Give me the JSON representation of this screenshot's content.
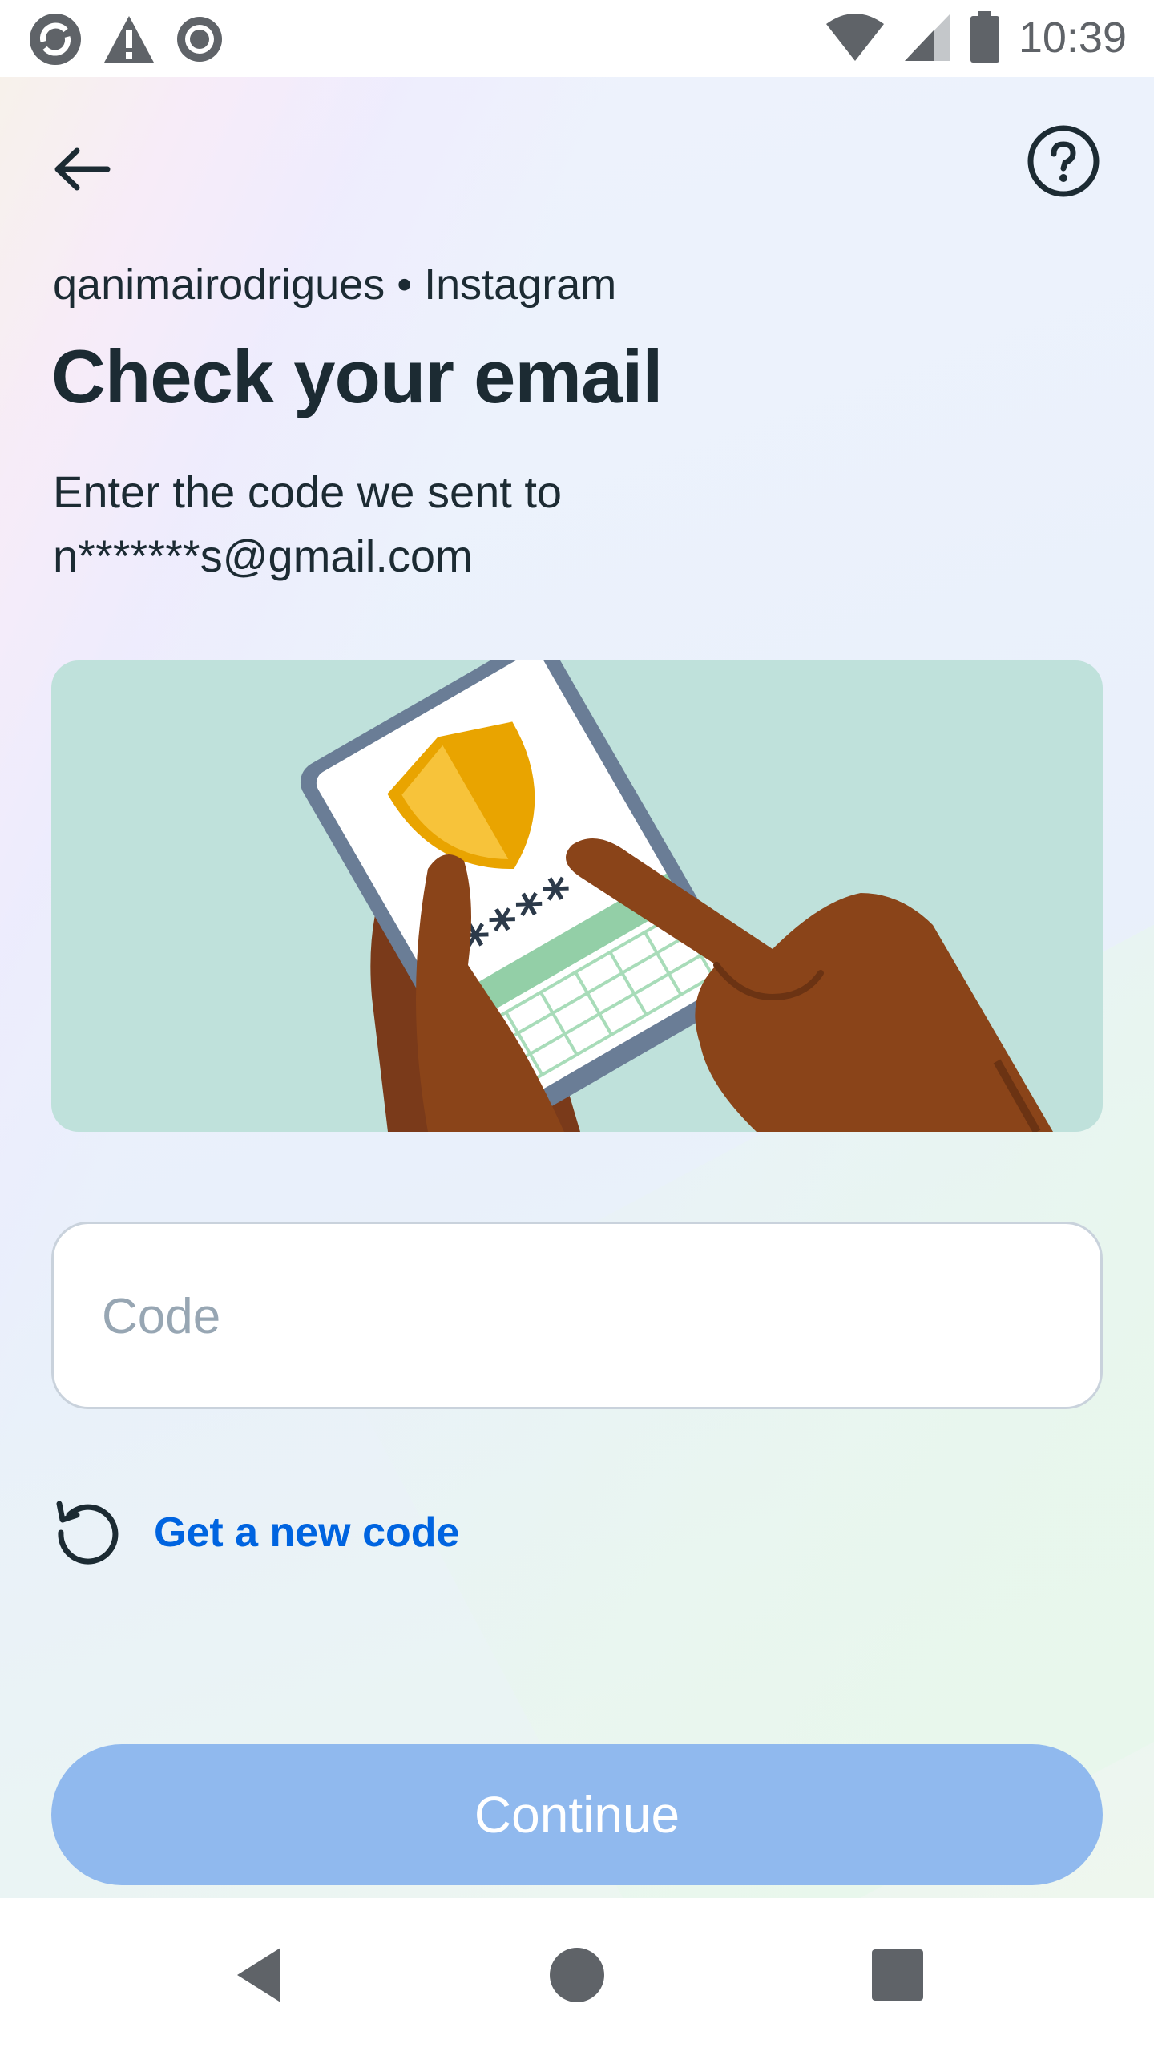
{
  "status_bar": {
    "time": "10:39",
    "left_icons": [
      "sync-icon",
      "warning-icon",
      "record-icon"
    ],
    "right_icons": [
      "wifi-icon",
      "signal-icon",
      "battery-icon"
    ]
  },
  "header": {
    "back_icon": "arrow-left-icon",
    "help_icon": "question-circle-icon"
  },
  "account_line": "qanimairodrigues • Instagram",
  "title": "Check your email",
  "description_line1": "Enter the code we sent to",
  "description_line2": "n*******s@gmail.com",
  "code_field": {
    "placeholder": "Code",
    "value": ""
  },
  "new_code_link": {
    "icon": "refresh-icon",
    "label": "Get a new code"
  },
  "continue_button": {
    "label": "Continue"
  },
  "colors": {
    "link": "#0064e0",
    "continue_disabled": "#90b9ee",
    "illustration_bg": "#bfe1db",
    "text_primary": "#1c2b33"
  },
  "nav_bar": {
    "icons": [
      "back-triangle-icon",
      "home-circle-icon",
      "recents-square-icon"
    ]
  }
}
